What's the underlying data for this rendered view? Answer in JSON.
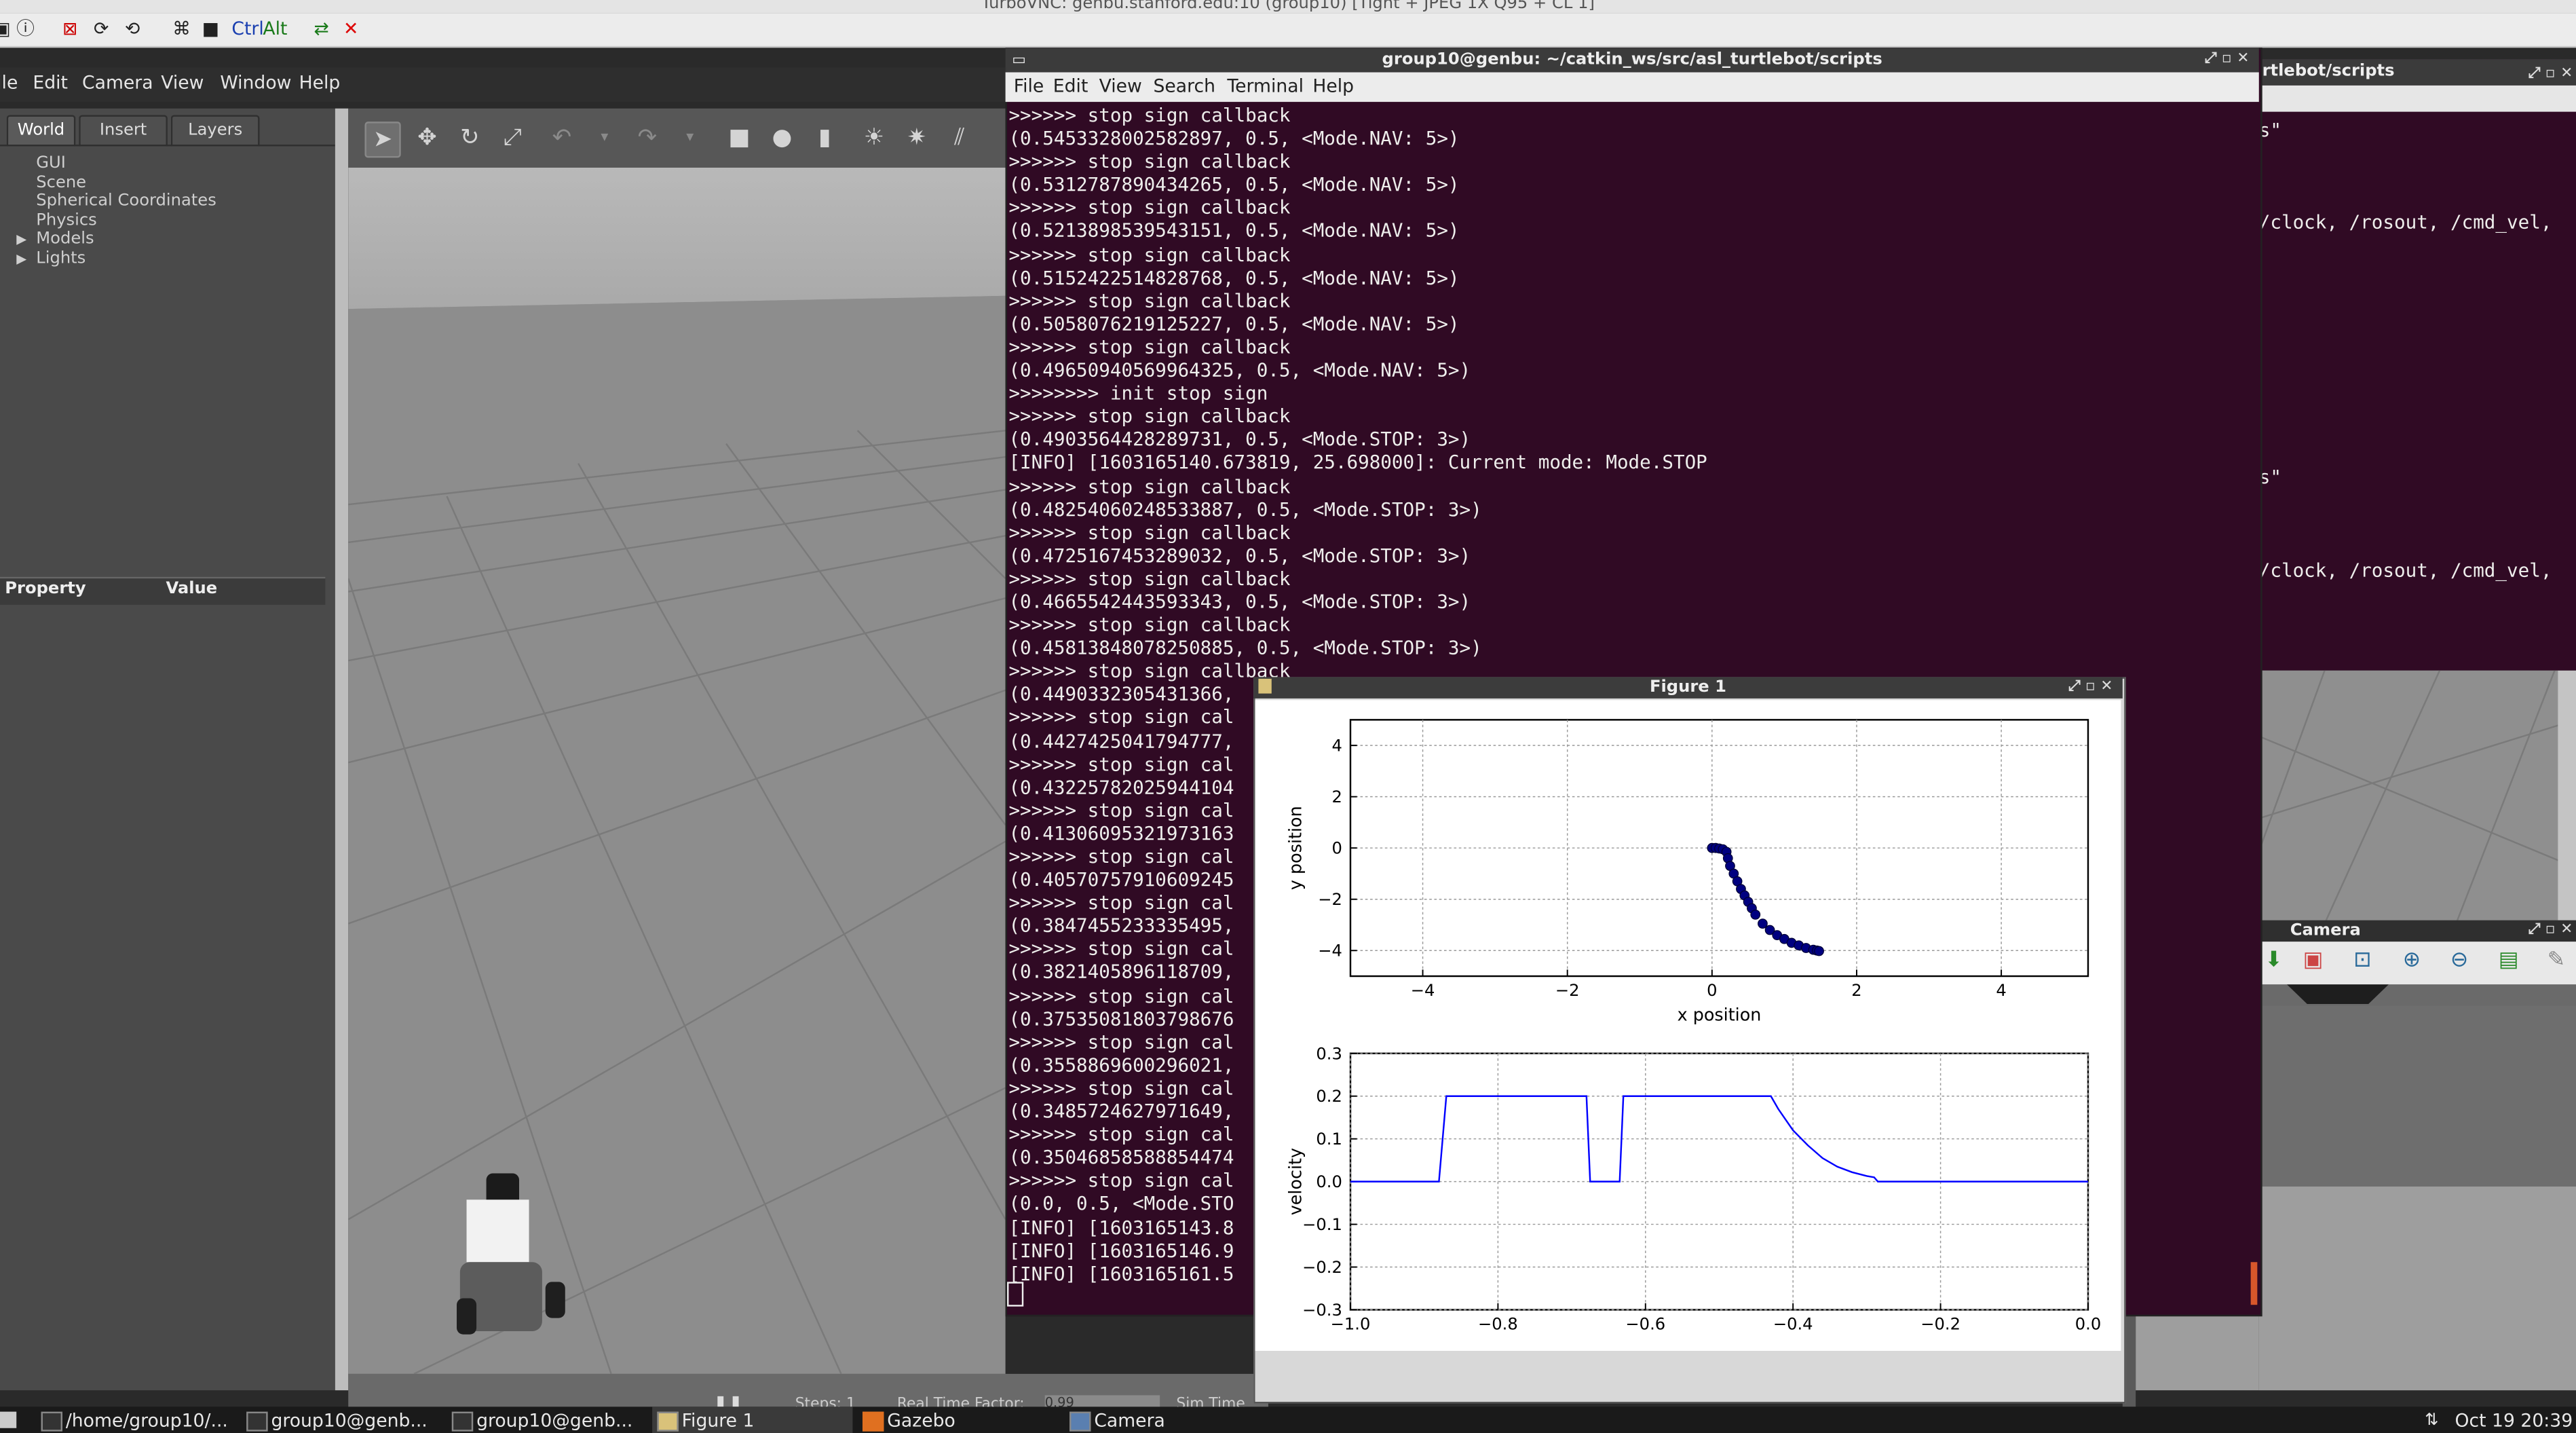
{
  "vnc": {
    "title": "TurboVNC: genbu.stanford.edu:10 (group10) [Tight + JPEG 1X Q95 + CL 1]",
    "ctrl_label": "Ctrl",
    "alt_label": "Alt"
  },
  "gazebo": {
    "menu": [
      "ile",
      "Edit",
      "Camera",
      "View",
      "Window",
      "Help"
    ],
    "tabs": [
      "World",
      "Insert",
      "Layers"
    ],
    "tree": [
      "GUI",
      "Scene",
      "Spherical Coordinates",
      "Physics",
      "Models",
      "Lights"
    ],
    "property_header": "Property",
    "value_header": "Value",
    "status": {
      "steps_label": "Steps: 1",
      "rtf_label": "Real Time Factor:",
      "rtf_value": "0.99",
      "sim_time_label": "Sim Time"
    }
  },
  "terminal": {
    "title": "group10@genbu: ~/catkin_ws/src/asl_turtlebot/scripts",
    "menu": [
      "File",
      "Edit",
      "View",
      "Search",
      "Terminal",
      "Help"
    ],
    "lines": [
      ">>>>>> stop sign callback",
      "(0.5453328002582897, 0.5, <Mode.NAV: 5>)",
      ">>>>>> stop sign callback",
      "(0.5312787890434265, 0.5, <Mode.NAV: 5>)",
      ">>>>>> stop sign callback",
      "(0.5213898539543151, 0.5, <Mode.NAV: 5>)",
      ">>>>>> stop sign callback",
      "(0.5152422514828768, 0.5, <Mode.NAV: 5>)",
      ">>>>>> stop sign callback",
      "(0.5058076219125227, 0.5, <Mode.NAV: 5>)",
      ">>>>>> stop sign callback",
      "(0.49650940569964325, 0.5, <Mode.NAV: 5>)",
      ">>>>>>>> init stop sign",
      ">>>>>> stop sign callback",
      "(0.4903564428289731, 0.5, <Mode.STOP: 3>)",
      "[INFO] [1603165140.673819, 25.698000]: Current mode: Mode.STOP",
      ">>>>>> stop sign callback",
      "(0.48254060248533887, 0.5, <Mode.STOP: 3>)",
      ">>>>>> stop sign callback",
      "(0.4725167453289032, 0.5, <Mode.STOP: 3>)",
      ">>>>>> stop sign callback",
      "(0.4665542443593343, 0.5, <Mode.STOP: 3>)",
      ">>>>>> stop sign callback",
      "(0.45813848078250885, 0.5, <Mode.STOP: 3>)",
      ">>>>>> stop sign callback",
      "(0.4490332305431366,",
      ">>>>>> stop sign cal",
      "(0.4427425041794777,",
      ">>>>>> stop sign cal",
      "(0.43225782025944104",
      ">>>>>> stop sign cal",
      "(0.41306095321973163",
      ">>>>>> stop sign cal",
      "(0.40570757910609245",
      ">>>>>> stop sign cal",
      "(0.3847455233335495,",
      ">>>>>> stop sign cal",
      "(0.3821405896118709,",
      ">>>>>> stop sign cal",
      "(0.37535081803798676",
      ">>>>>> stop sign cal",
      "(0.3558869600296021,",
      ">>>>>> stop sign cal",
      "(0.3485724627971649,",
      ">>>>>> stop sign cal",
      "(0.35046858588854474",
      ">>>>>> stop sign cal",
      "(0.0, 0.5, <Mode.STO",
      "[INFO] [1603165143.8",
      "[INFO] [1603165146.9",
      "[INFO] [1603165161.5"
    ]
  },
  "terminal2": {
    "title": "rtlebot/scripts",
    "lines": [
      "s\"",
      "",
      "",
      "",
      "/clock, /rosout, /cmd_vel,",
      "",
      "",
      "",
      "",
      "",
      "",
      "",
      "",
      "",
      "",
      "s\"",
      "",
      "",
      "",
      "/clock, /rosout, /cmd_vel,"
    ]
  },
  "camera": {
    "title": "Camera"
  },
  "figure": {
    "title": "Figure 1"
  },
  "chart_data": [
    {
      "type": "scatter",
      "xlabel": "x position",
      "ylabel": "y position",
      "xlim": [
        -5,
        5.2
      ],
      "ylim": [
        -5,
        5
      ],
      "xticks": [
        -4,
        -2,
        0,
        2,
        4
      ],
      "yticks": [
        -4,
        -2,
        0,
        2,
        4
      ],
      "grid": true,
      "color": "#000080",
      "x": [
        0.0,
        0.05,
        0.1,
        0.15,
        0.2,
        0.22,
        0.25,
        0.3,
        0.35,
        0.4,
        0.45,
        0.5,
        0.55,
        0.6,
        0.7,
        0.8,
        0.9,
        1.0,
        1.1,
        1.2,
        1.3,
        1.4,
        1.45,
        1.48
      ],
      "y": [
        0.0,
        0.0,
        -0.02,
        -0.05,
        -0.15,
        -0.4,
        -0.7,
        -1.0,
        -1.3,
        -1.6,
        -1.85,
        -2.1,
        -2.35,
        -2.6,
        -2.95,
        -3.2,
        -3.4,
        -3.55,
        -3.7,
        -3.8,
        -3.9,
        -3.97,
        -4.0,
        -4.02
      ]
    },
    {
      "type": "line",
      "xlabel": "",
      "ylabel": "velocity",
      "xlim": [
        -1.0,
        0.0
      ],
      "ylim": [
        -0.3,
        0.3
      ],
      "xticks": [
        -1.0,
        -0.8,
        -0.6,
        -0.4,
        -0.2,
        0.0
      ],
      "yticks": [
        -0.3,
        -0.2,
        -0.1,
        0.0,
        0.1,
        0.2,
        0.3
      ],
      "grid": true,
      "color": "#0000ff",
      "x": [
        -1.0,
        -0.88,
        -0.87,
        -0.68,
        -0.675,
        -0.635,
        -0.63,
        -0.43,
        -0.42,
        -0.4,
        -0.38,
        -0.36,
        -0.34,
        -0.32,
        -0.3,
        -0.29,
        -0.285,
        -0.2,
        -0.1,
        0.0
      ],
      "y": [
        0.0,
        0.0,
        0.2,
        0.2,
        0.0,
        0.0,
        0.2,
        0.2,
        0.17,
        0.12,
        0.085,
        0.055,
        0.035,
        0.022,
        0.013,
        0.01,
        0.0,
        0.0,
        0.0,
        0.0
      ]
    }
  ],
  "taskbar": {
    "items": [
      "/home/group10/...",
      "group10@genb...",
      "group10@genb...",
      "Figure 1",
      "Gazebo",
      "Camera"
    ],
    "clock": "Oct 19 20:39"
  }
}
